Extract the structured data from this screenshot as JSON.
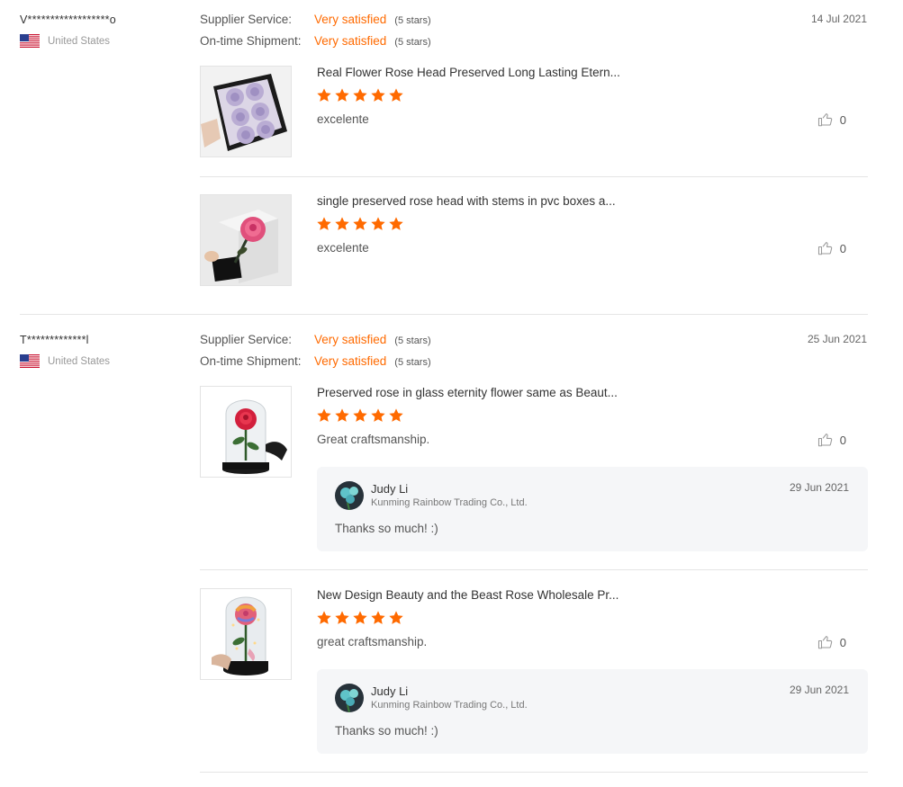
{
  "reviews": [
    {
      "reviewer": "V******************o",
      "country": "United States",
      "date": "14 Jul 2021",
      "supplier_service": {
        "label": "Supplier Service:",
        "value": "Very satisfied",
        "stars_text": "(5 stars)",
        "stars": 5
      },
      "on_time_shipment": {
        "label": "On-time Shipment:",
        "value": "Very satisfied",
        "stars_text": "(5 stars)",
        "stars": 5
      },
      "products": [
        {
          "title": "Real Flower Rose Head Preserved Long Lasting Etern...",
          "rating": 5,
          "comment": "excelente",
          "likes": "0",
          "thumb_icon": "lavender-roses-box-photo"
        },
        {
          "title": "single preserved rose head with stems in pvc boxes a...",
          "rating": 5,
          "comment": "excelente",
          "likes": "0",
          "thumb_icon": "pink-rose-pvc-box-photo"
        }
      ]
    },
    {
      "reviewer": "T*************l",
      "country": "United States",
      "date": "25 Jun 2021",
      "supplier_service": {
        "label": "Supplier Service:",
        "value": "Very satisfied",
        "stars_text": "(5 stars)",
        "stars": 5
      },
      "on_time_shipment": {
        "label": "On-time Shipment:",
        "value": "Very satisfied",
        "stars_text": "(5 stars)",
        "stars": 5
      },
      "products": [
        {
          "title": "Preserved rose in glass eternity flower same as Beaut...",
          "rating": 5,
          "comment": "Great craftsmanship.",
          "likes": "0",
          "thumb_icon": "red-rose-glass-dome-photo",
          "reply": {
            "name": "Judy Li",
            "company": "Kunming Rainbow Trading Co., Ltd.",
            "date": "29 Jun 2021",
            "text": "Thanks so much! :)"
          }
        },
        {
          "title": "New Design Beauty and the Beast Rose Wholesale Pr...",
          "rating": 5,
          "comment": "great craftsmanship.",
          "likes": "0",
          "thumb_icon": "rainbow-rose-glass-dome-photo",
          "reply": {
            "name": "Judy Li",
            "company": "Kunming Rainbow Trading Co., Ltd.",
            "date": "29 Jun 2021",
            "text": "Thanks so much! :)"
          }
        }
      ]
    }
  ],
  "colors": {
    "accent": "#ff6a00",
    "star": "#ff6a00",
    "divider": "#e5e5e5",
    "reply_bg": "#f5f6f8"
  }
}
